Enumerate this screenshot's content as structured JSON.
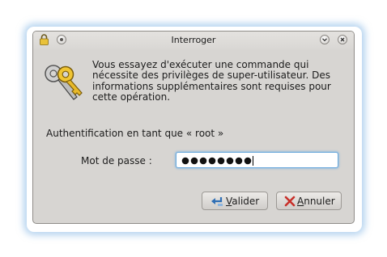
{
  "window": {
    "title": "Interroger",
    "buttons": {
      "help": "help",
      "minimize": "minimize",
      "close": "close"
    }
  },
  "dialog": {
    "message": "Vous essayez d'exécuter une commande qui nécessite des privilèges de super-utilisateur. Des informations supplémentaires sont requises pour cette opération.",
    "auth_text": "Authentification en tant que « root »",
    "password_label": "Mot de passe :",
    "password_length": 8
  },
  "buttons": {
    "ok_mnemonic": "V",
    "ok_rest": "alider",
    "cancel_mnemonic": "A",
    "cancel_rest": "nnuler"
  },
  "icons": {
    "window": "lock-icon",
    "dialog": "keys-icon",
    "ok": "confirm-arrow-icon",
    "cancel": "cancel-x-icon"
  },
  "colors": {
    "window_bg": "#d7d5d2",
    "focus_ring": "#6aa8db",
    "glow": "#78afe1"
  }
}
